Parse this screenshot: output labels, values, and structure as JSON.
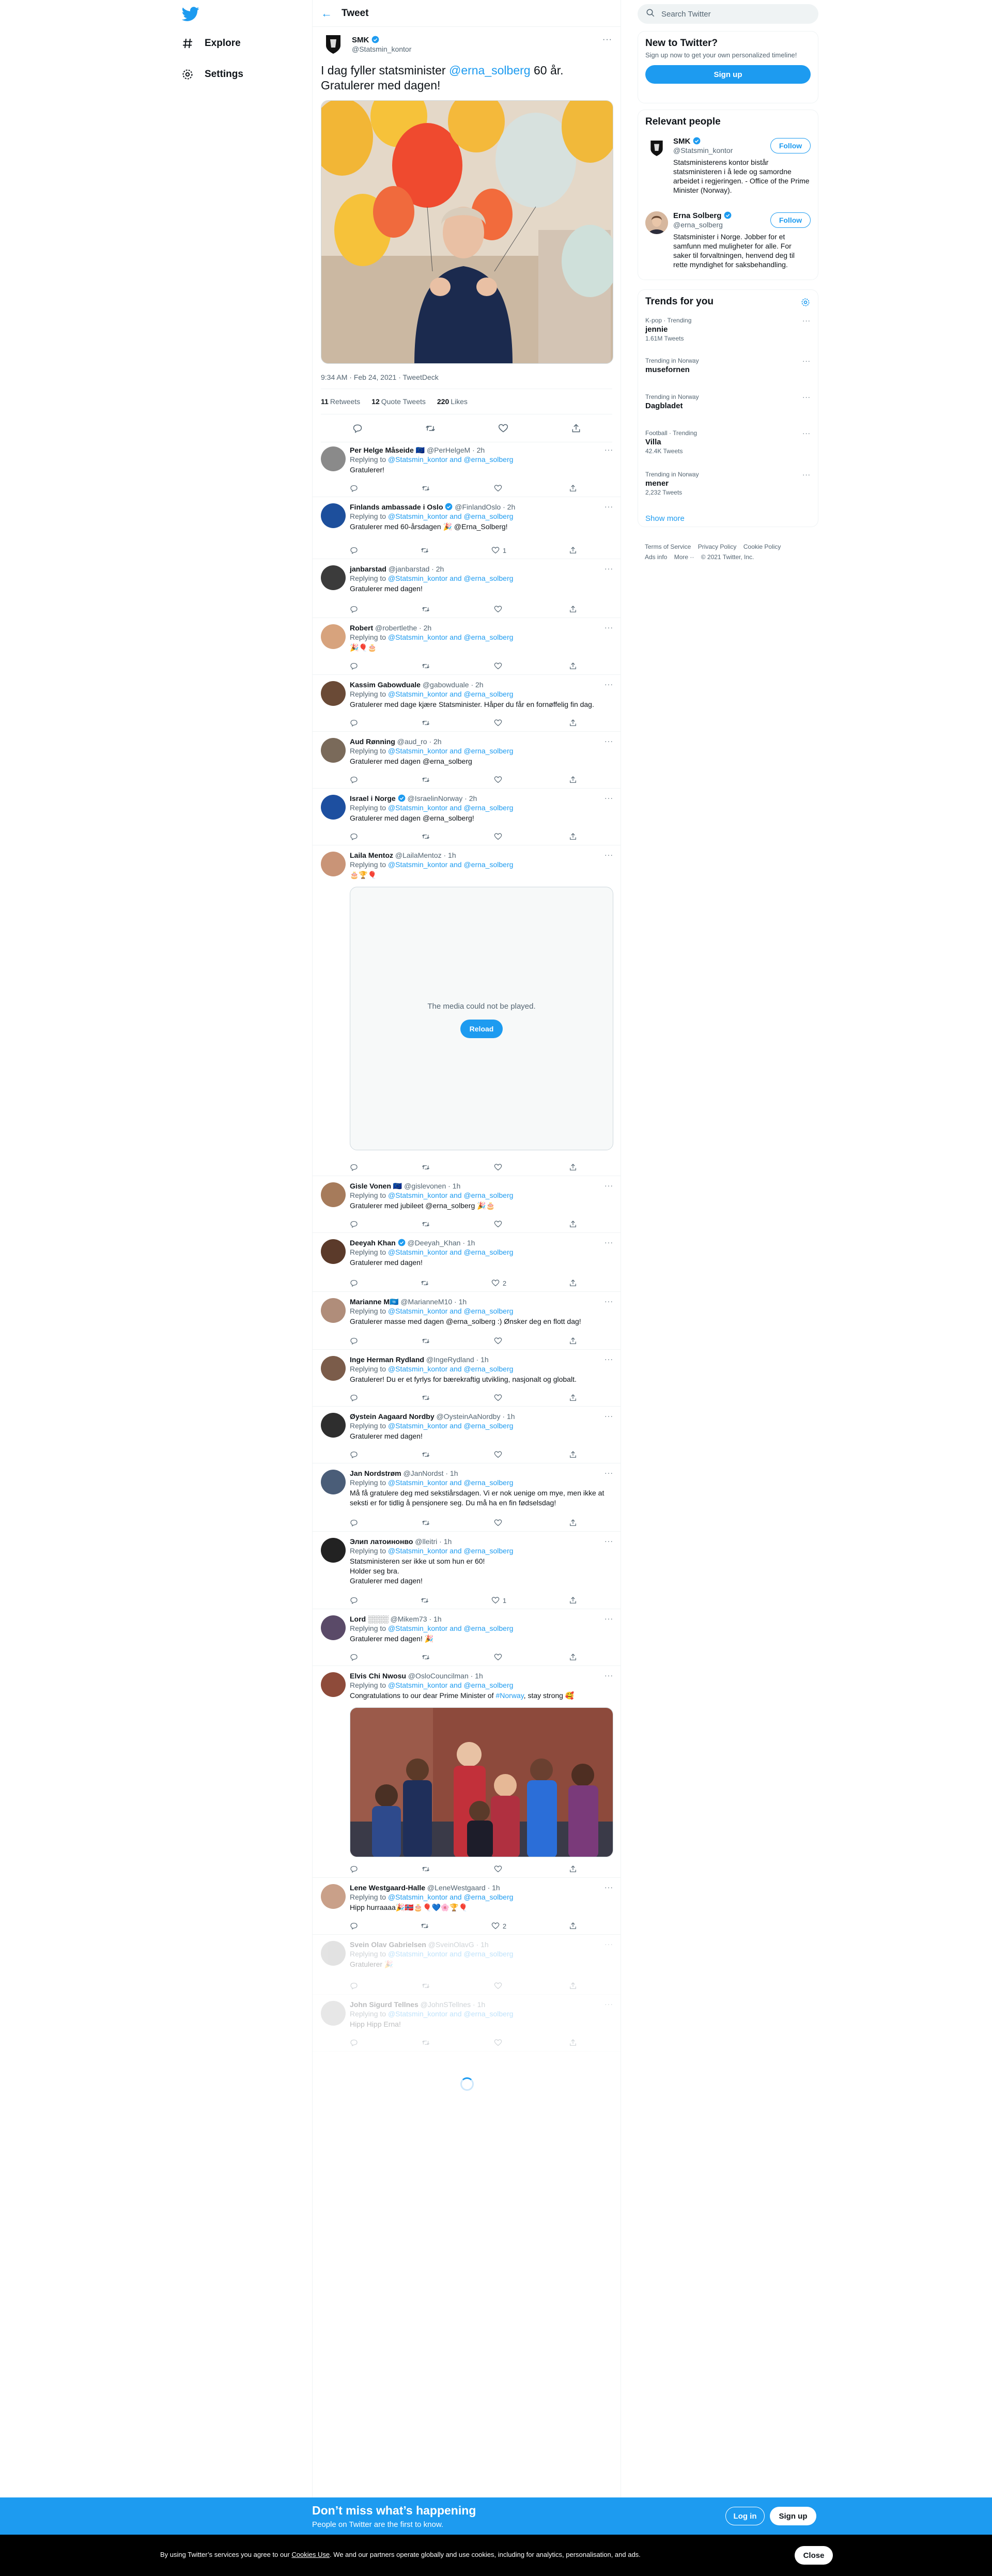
{
  "nav": {
    "logo_icon": "twitter-bird-icon",
    "items": [
      {
        "label": "Explore",
        "icon": "hashtag-icon"
      },
      {
        "label": "Settings",
        "icon": "gear-icon"
      }
    ]
  },
  "header": {
    "title": "Tweet",
    "back_icon": "arrow-left-icon"
  },
  "focal_tweet": {
    "name": "SMK",
    "handle": "@Statsmin_kontor",
    "text_prefix": "I dag fyller statsminister ",
    "mention": "@erna_solberg",
    "text_suffix": " 60 år. Gratulerer med dagen!",
    "meta": "9:34 AM · Feb 24, 2021 · TweetDeck",
    "retweets": "11",
    "retweets_label": "Retweets",
    "quotes": "12",
    "quotes_label": "Quote Tweets",
    "likes": "220",
    "likes_label": "Likes"
  },
  "replying_prefix": "Replying to ",
  "replying_to_1": "@Statsmin_kontor",
  "replying_and": " and ",
  "replying_to_2": "@erna_solberg",
  "replies": [
    {
      "name": "Per Helge Måseide 🇪🇺",
      "handle": "@PerHelgeM · 2h",
      "text": "Gratulerer!",
      "likes": ""
    },
    {
      "name": "Finlands ambassade i Oslo",
      "handle": "@FinlandOslo · 2h",
      "text": "Gratulerer med 60-årsdagen 🎉 @Erna_Solberg!",
      "likes": "1"
    },
    {
      "name": "janbarstad",
      "handle": "@janbarstad · 2h",
      "text": "Gratulerer med dagen!",
      "likes": ""
    },
    {
      "name": "Robert",
      "handle": "@robertlethe · 2h",
      "text": "🎉🎈🎂",
      "likes": ""
    },
    {
      "name": "Kassim Gabowduale",
      "handle": "@gabowduale · 2h",
      "text": "Gratulerer med dage kjære Statsminister. Håper du får en fornøffelig fin dag.",
      "likes": ""
    },
    {
      "name": "Aud Rønning",
      "handle": "@aud_ro · 2h",
      "text": "Gratulerer med dagen @erna_solberg",
      "likes": ""
    },
    {
      "name": "Israel i Norge",
      "handle": "@IsraelinNorway · 2h",
      "text": "Gratulerer med dagen @erna_solberg!",
      "likes": ""
    },
    {
      "name": "Laila Mentoz",
      "handle": "@LailaMentoz · 1h",
      "text": "🎂🏆🎈",
      "likes": ""
    },
    {
      "name": "Gisle Vonen 🇪🇺",
      "handle": "@gislevonen · 1h",
      "text": "Gratulerer med jubileet @erna_solberg 🎉🎂",
      "likes": ""
    },
    {
      "name": "Deeyah Khan",
      "handle": "@Deeyah_Khan · 1h",
      "text": "Gratulerer med dagen!",
      "likes": "2"
    },
    {
      "name": "Marianne M🇺🇳",
      "handle": "@MarianneM10 · 1h",
      "text": "Gratulerer masse med dagen @erna_solberg :) Ønsker deg en flott dag!",
      "likes": ""
    },
    {
      "name": "Inge Herman Rydland",
      "handle": "@IngeRydland · 1h",
      "text": "Gratulerer! Du er et fyrlys for bærekraftig utvikling, nasjonalt og globalt.",
      "likes": ""
    },
    {
      "name": "Øystein Aagaard Nordby",
      "handle": "@OysteinAaNordby · 1h",
      "text": "Gratulerer med dagen!",
      "likes": ""
    },
    {
      "name": "Jan Nordstrøm",
      "handle": "@JanNordst · 1h",
      "text": "Må få gratulere deg med sekstiårsdagen. Vi er nok uenige om mye, men ikke at seksti er for tidlig å pensjonere seg. Du må ha en fin fødselsdag!",
      "likes": ""
    },
    {
      "name": "Элип латоинонво",
      "handle": "@lleitri · 1h",
      "text": "Statsministeren ser ikke ut som hun er 60!\nHolder seg bra.\nGratulerer med dagen!",
      "likes": "1"
    },
    {
      "name": "Lord ░░░░",
      "handle": "@Mikem73 · 1h",
      "text": "Gratulerer med dagen! 🎉",
      "likes": ""
    },
    {
      "name": "Elvis Chi Nwosu",
      "handle": "@OsloCouncilman · 1h",
      "text_prefix": "Congratulations to our dear Prime Minister of ",
      "hashtag": "#Norway",
      "text_suffix": ", stay strong 🥰",
      "likes": ""
    },
    {
      "name": "Lene Westgaard-Halle",
      "handle": "@LeneWestgaard · 1h",
      "text": "Hipp hurraaaa🎉🇳🇴🎂🎈💙🌸🏆🎈",
      "likes": "2"
    },
    {
      "name": "Svein Olav Gabrielsen",
      "handle": "@SveinOlavG · 1h",
      "text": "Gratulerer 🎉",
      "likes": ""
    },
    {
      "name": "John Sigurd Tellnes",
      "handle": "@JohnSTellnes · 1h",
      "text": "Hipp Hipp Erna!",
      "likes": ""
    }
  ],
  "media_error": {
    "message": "The media could not be played.",
    "reload_label": "Reload"
  },
  "sidebar": {
    "search_placeholder": "Search Twitter",
    "new_title": "New to Twitter?",
    "new_sub": "Sign up now to get your own personalized timeline!",
    "signup_label": "Sign up",
    "relevant_title": "Relevant people",
    "people": [
      {
        "name": "SMK",
        "handle": "@Statsmin_kontor",
        "bio": "Statsministerens kontor bistår statsministeren i å lede og samordne arbeidet i regjeringen. - Office of the Prime Minister (Norway).",
        "follow": "Follow"
      },
      {
        "name": "Erna Solberg",
        "handle": "@erna_solberg",
        "bio": "Statsminister i Norge. Jobber for et samfunn med muligheter for alle. For saker til forvaltningen, henvend deg til rette myndighet for saksbehandling.",
        "follow": "Follow"
      }
    ],
    "trends_title": "Trends for you",
    "trends": [
      {
        "context": "K-pop · Trending",
        "name": "jennie",
        "count": "1.61M Tweets"
      },
      {
        "context": "Trending in Norway",
        "name": "musefornen",
        "count": ""
      },
      {
        "context": "Trending in Norway",
        "name": "Dagbladet",
        "count": ""
      },
      {
        "context": "Football · Trending",
        "name": "Villa",
        "count": "42.4K Tweets"
      },
      {
        "context": "Trending in Norway",
        "name": "mener",
        "count": "2,232 Tweets"
      }
    ],
    "show_more": "Show more",
    "footer_line1": [
      "Terms of Service",
      "Privacy Policy",
      "Cookie Policy"
    ],
    "footer_line2": [
      "Ads info",
      "More ··",
      "© 2021 Twitter, Inc."
    ]
  },
  "bottom_bar": {
    "title": "Don’t miss what’s happening",
    "subtitle": "People on Twitter are the first to know.",
    "login_label": "Log in",
    "signup_label": "Sign up"
  },
  "cookie_bar": {
    "text_before": "By using Twitter’s services you agree to our ",
    "link_text": "Cookies Use",
    "text_after": ". We and our partners operate globally and use cookies, including for analytics, personalisation, and ads.",
    "close_label": "Close"
  },
  "colors": {
    "accent": "#1d9bf0",
    "text": "#0f1419",
    "secondary": "#536471",
    "cookie_bg": "#000000"
  }
}
